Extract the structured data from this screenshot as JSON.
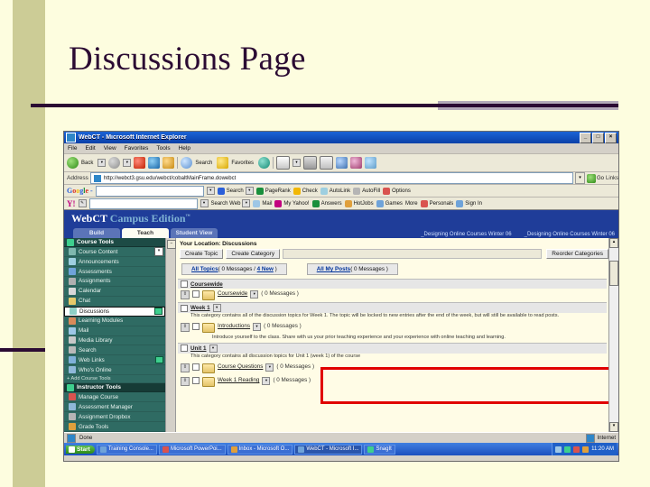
{
  "slide": {
    "title": "Discussions Page"
  },
  "browser": {
    "window_title": "WebCT - Microsoft Internet Explorer",
    "window_buttons": {
      "minimize": "_",
      "maximize": "□",
      "close": "×"
    },
    "menus": [
      "File",
      "Edit",
      "View",
      "Favorites",
      "Tools",
      "Help"
    ],
    "toolbar": {
      "back": "Back",
      "forward": "",
      "search": "Search",
      "favorites": "Favorites"
    },
    "address": {
      "label": "Address",
      "url": "http://webct3.gsu.edu/webct/cobaltMainFrame.dowebct",
      "go": "Go",
      "links": "Links"
    },
    "google_toolbar": {
      "logo_parts": [
        "G",
        "o",
        "o",
        "g",
        "l",
        "e"
      ],
      "suffix": " -",
      "value": "",
      "search_button": "Search",
      "items": [
        "PageRank",
        "Check",
        "AutoLink",
        "AutoFill",
        "Options"
      ]
    },
    "yahoo_toolbar": {
      "logo": "Y!",
      "value": "",
      "search_button": "Search Web",
      "items": [
        "Mail",
        "My Yahoo!",
        "Answers",
        "HotJobs",
        "Games",
        "More",
        "Personals",
        "Sign In"
      ]
    },
    "status": {
      "text": "Done",
      "zone": "Internet"
    }
  },
  "webct": {
    "logo": {
      "brand": "WebCT",
      "edition": "Campus Edition",
      "tm": "™"
    },
    "tabs": [
      {
        "label": "Build",
        "active": false
      },
      {
        "label": "Teach",
        "active": true
      },
      {
        "label": "Student View",
        "active": false
      }
    ],
    "breadcrumbs": [
      "_Designing Online Courses Winter 06",
      "_Designing Online Courses Winter 06"
    ],
    "sidebar": {
      "course_tools_header": "Course Tools",
      "course_tools": [
        {
          "label": "Course Content",
          "icon": "content-icon",
          "color": "#7fb7ae",
          "chevron": true
        },
        {
          "label": "Announcements",
          "icon": "announcement-icon",
          "color": "#9ecfe0"
        },
        {
          "label": "Assessments",
          "icon": "assessment-icon",
          "color": "#6fa3d9"
        },
        {
          "label": "Assignments",
          "icon": "assignment-icon",
          "color": "#b0b0b0"
        },
        {
          "label": "Calendar",
          "icon": "calendar-icon",
          "color": "#d8d8d8"
        },
        {
          "label": "Chat",
          "icon": "chat-icon",
          "color": "#e6c96a"
        },
        {
          "label": "Discussions",
          "icon": "discussions-icon",
          "color": "#8fd0c6",
          "selected": true,
          "badge": true
        },
        {
          "label": "Learning Modules",
          "icon": "modules-icon",
          "color": "#d98a5a"
        },
        {
          "label": "Mail",
          "icon": "mail-icon",
          "color": "#9ec7e6"
        },
        {
          "label": "Media Library",
          "icon": "media-icon",
          "color": "#c8c8c8"
        },
        {
          "label": "Search",
          "icon": "search-icon",
          "color": "#b9b9b9"
        },
        {
          "label": "Web Links",
          "icon": "weblinks-icon",
          "color": "#7fb0d9",
          "badge": true
        },
        {
          "label": "Who's Online",
          "icon": "whosonline-icon",
          "color": "#8fb8d9"
        }
      ],
      "add_link": "+ Add Course Tools",
      "instructor_tools_header": "Instructor Tools",
      "instructor_tools": [
        {
          "label": "Manage Course",
          "icon": "manage-icon",
          "color": "#d9534f"
        },
        {
          "label": "Assessment Manager",
          "icon": "assessment-manager-icon",
          "color": "#8fb8d9"
        },
        {
          "label": "Assignment Dropbox",
          "icon": "dropbox-icon",
          "color": "#b5b5b5"
        },
        {
          "label": "Grade Tools",
          "icon": "grades-icon",
          "color": "#e0a03c"
        }
      ]
    },
    "main": {
      "location": "Your Location: Discussions",
      "buttons": [
        "Create Topic",
        "Create Category"
      ],
      "reorder_label": "Reorder Categories",
      "summary": [
        {
          "link": "All Topics",
          "detail": "( 0 Messages / ",
          "new_link": "4 New",
          "tail": " )"
        },
        {
          "link": "All My Posts",
          "detail": "( 0 Messages )",
          "new_link": "",
          "tail": ""
        }
      ],
      "categories": [
        {
          "name": "Coursewide",
          "description": "",
          "is_topic_only": true,
          "topics": [
            {
              "name": "Coursewide",
              "messages": "( 0 Messages )",
              "description": ""
            }
          ]
        },
        {
          "name": "Week 1",
          "description": "This category contains all of the discussion topics for Week 1. The topic will be locked to new entries after the end of the week, but will still be available to read posts.",
          "topics": [
            {
              "name": "Introductions",
              "messages": "( 0 Messages )",
              "description": "Introduce yourself to the class. Share with us your prior teaching experience and your experience with online teaching and learning."
            }
          ]
        },
        {
          "name": "Unit 1",
          "description": "This category contains all discussion topics for Unit 1 (week 1) of the course",
          "topics": [
            {
              "name": "Course Questions",
              "messages": "( 0 Messages )",
              "description": ""
            },
            {
              "name": "Week 1 Reading",
              "messages": "( 0 Messages )",
              "description": ""
            }
          ]
        }
      ]
    }
  },
  "taskbar": {
    "start": "Start",
    "items": [
      {
        "label": "Training Console...",
        "color": "#6fa3d9",
        "active": false
      },
      {
        "label": "Microsoft PowerPoi...",
        "color": "#d9534f",
        "active": false
      },
      {
        "label": "Inbox - Microsoft O...",
        "color": "#e0a03c",
        "active": false
      },
      {
        "label": "WebCT - Microsoft I...",
        "color": "#6fa3d9",
        "active": true
      },
      {
        "label": "SnagIt",
        "color": "#3ecf8e",
        "active": false
      }
    ],
    "clock": "11:20 AM"
  }
}
